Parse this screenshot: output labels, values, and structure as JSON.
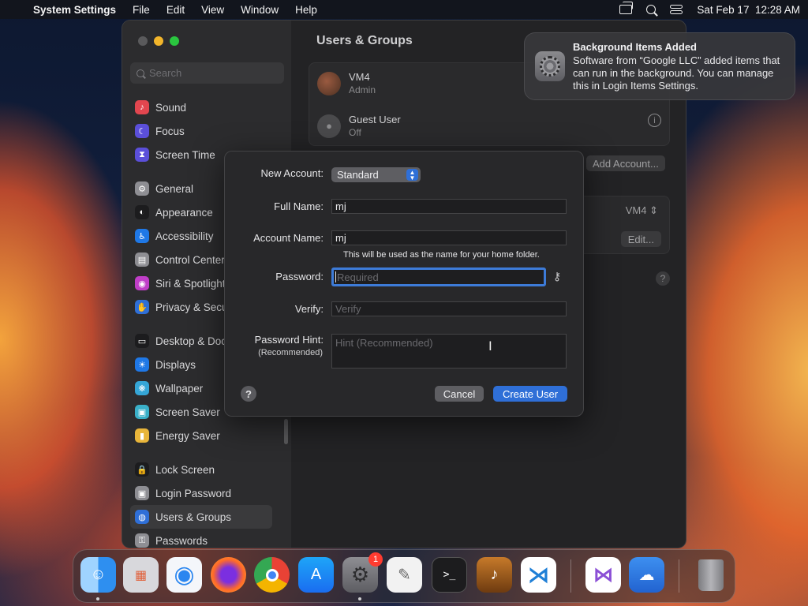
{
  "menubar": {
    "app_name": "System Settings",
    "menus": [
      "File",
      "Edit",
      "View",
      "Window",
      "Help"
    ],
    "datetime": "Sat Feb 17  12:28 AM"
  },
  "window": {
    "search_placeholder": "Search",
    "sidebar": [
      {
        "label": "Sound",
        "icon": "speaker-icon",
        "color": "#e2464f"
      },
      {
        "label": "Focus",
        "icon": "moon-icon",
        "color": "#5b4fd9"
      },
      {
        "label": "Screen Time",
        "icon": "hourglass-icon",
        "color": "#5b4fd9"
      },
      {
        "label": "General",
        "icon": "gear-icon",
        "color": "#8e8e93"
      },
      {
        "label": "Appearance",
        "icon": "appearance-icon",
        "color": "#1c1c1e"
      },
      {
        "label": "Accessibility",
        "icon": "accessibility-icon",
        "color": "#1f78e6"
      },
      {
        "label": "Control Center",
        "icon": "control-center-icon",
        "color": "#8e8e93"
      },
      {
        "label": "Siri & Spotlight",
        "icon": "siri-icon",
        "color": "#c03ec8"
      },
      {
        "label": "Privacy & Security",
        "icon": "hand-icon",
        "color": "#2f6fd7"
      },
      {
        "label": "Desktop & Dock",
        "icon": "desktop-icon",
        "color": "#1c1c1e"
      },
      {
        "label": "Displays",
        "icon": "sun-icon",
        "color": "#1f78e6"
      },
      {
        "label": "Wallpaper",
        "icon": "wallpaper-icon",
        "color": "#35a6d6"
      },
      {
        "label": "Screen Saver",
        "icon": "screensaver-icon",
        "color": "#3ab0c8"
      },
      {
        "label": "Energy Saver",
        "icon": "battery-icon",
        "color": "#e8b53a"
      },
      {
        "label": "Lock Screen",
        "icon": "lock-icon",
        "color": "#1c1c1e"
      },
      {
        "label": "Login Password",
        "icon": "lock-password-icon",
        "color": "#8e8e93"
      },
      {
        "label": "Users & Groups",
        "icon": "users-icon",
        "color": "#2f6fd7"
      },
      {
        "label": "Passwords",
        "icon": "key-icon",
        "color": "#8e8e93"
      }
    ],
    "content_title": "Users & Groups",
    "users": [
      {
        "name": "VM4",
        "role": "Admin"
      },
      {
        "name": "Guest User",
        "role": "Off"
      }
    ],
    "add_account_label": "Add Account...",
    "auto_login_value": "VM4",
    "edit_label": "Edit..."
  },
  "dialog": {
    "new_account_label": "New Account:",
    "new_account_value": "Standard",
    "full_name_label": "Full Name:",
    "full_name_value": "mj",
    "account_name_label": "Account Name:",
    "account_name_value": "mj",
    "account_name_note": "This will be used as the name for your home folder.",
    "password_label": "Password:",
    "password_placeholder": "Required",
    "verify_label": "Verify:",
    "verify_placeholder": "Verify",
    "hint_label": "Password Hint:",
    "hint_sublabel": "(Recommended)",
    "hint_placeholder": "Hint (Recommended)",
    "help_label": "?",
    "cancel_label": "Cancel",
    "create_label": "Create User"
  },
  "notification": {
    "title": "Background Items Added",
    "body": "Software from “Google LLC” added items that can run in the background. You can manage this in Login Items Settings."
  },
  "dock": {
    "settings_badge": "1"
  }
}
